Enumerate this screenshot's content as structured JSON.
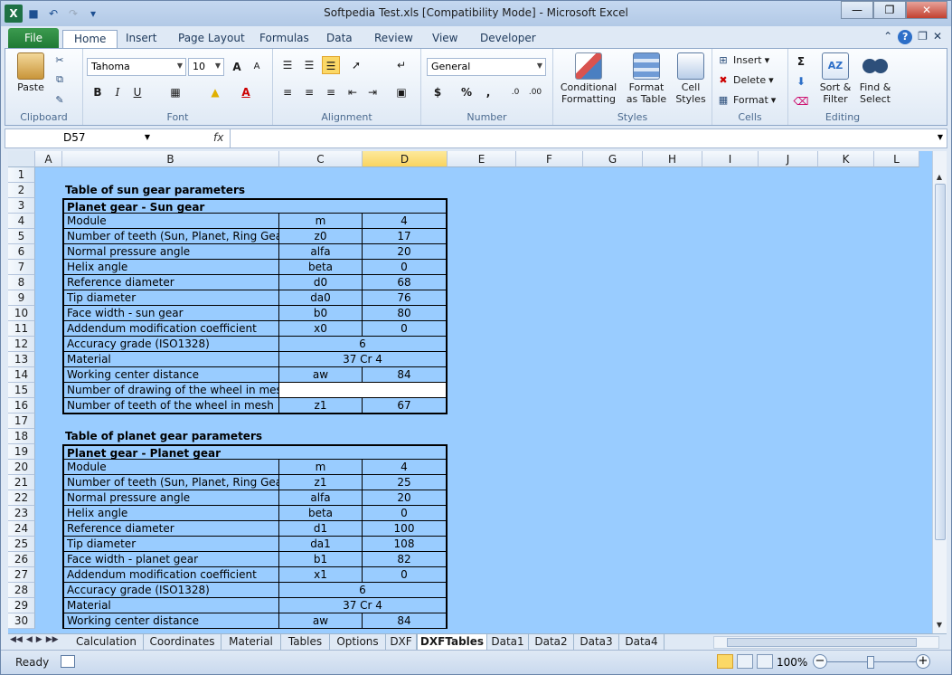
{
  "window": {
    "title": "Softpedia Test.xls  [Compatibility Mode]  -  Microsoft Excel"
  },
  "ribbon_tabs": [
    "File",
    "Home",
    "Insert",
    "Page Layout",
    "Formulas",
    "Data",
    "Review",
    "View",
    "Developer"
  ],
  "ribbon": {
    "clipboard": {
      "paste": "Paste",
      "label": "Clipboard"
    },
    "font": {
      "name": "Tahoma",
      "size": "10",
      "label": "Font",
      "bold": "B",
      "italic": "I",
      "underline": "U"
    },
    "alignment": {
      "label": "Alignment"
    },
    "number": {
      "format": "General",
      "currency": "$",
      "percent": "%",
      "comma": ",",
      "label": "Number"
    },
    "styles": {
      "conditional": "Conditional Formatting",
      "format_table": "Format as Table",
      "cell_styles": "Cell Styles",
      "label": "Styles"
    },
    "cells": {
      "insert": "Insert",
      "delete": "Delete",
      "format": "Format",
      "label": "Cells"
    },
    "editing": {
      "sigma": "Σ",
      "sort": "Sort & Filter",
      "find": "Find & Select",
      "label": "Editing"
    }
  },
  "formula_bar": {
    "name_box": "D57",
    "fx": "fx",
    "value": ""
  },
  "columns": [
    {
      "name": "A",
      "selected": false
    },
    {
      "name": "B",
      "selected": false
    },
    {
      "name": "C",
      "selected": false
    },
    {
      "name": "D",
      "selected": true
    },
    {
      "name": "E",
      "selected": false
    },
    {
      "name": "F",
      "selected": false
    },
    {
      "name": "G",
      "selected": false
    },
    {
      "name": "H",
      "selected": false
    },
    {
      "name": "I",
      "selected": false
    },
    {
      "name": "J",
      "selected": false
    },
    {
      "name": "K",
      "selected": false
    },
    {
      "name": "L",
      "selected": false
    }
  ],
  "rows": [
    {
      "n": "1",
      "b": "",
      "c": "",
      "d": "",
      "kind": "blank"
    },
    {
      "n": "2",
      "b": "Table of sun gear parameters",
      "c": "",
      "d": "",
      "kind": "title"
    },
    {
      "n": "3",
      "b": "Planet gear - Sun gear",
      "c": "",
      "d": "",
      "kind": "header"
    },
    {
      "n": "4",
      "b": "Module",
      "c": "m",
      "d": "4",
      "kind": "data"
    },
    {
      "n": "5",
      "b": "Number of teeth (Sun, Planet, Ring Gear)",
      "c": "z0",
      "d": "17",
      "kind": "data"
    },
    {
      "n": "6",
      "b": "Normal pressure angle",
      "c": "alfa",
      "d": "20",
      "kind": "data"
    },
    {
      "n": "7",
      "b": "Helix angle",
      "c": "beta",
      "d": "0",
      "kind": "data"
    },
    {
      "n": "8",
      "b": "Reference diameter",
      "c": "d0",
      "d": "68",
      "kind": "data"
    },
    {
      "n": "9",
      "b": "Tip diameter",
      "c": "da0",
      "d": "76",
      "kind": "data"
    },
    {
      "n": "10",
      "b": "Face width - sun gear",
      "c": "b0",
      "d": "80",
      "kind": "data"
    },
    {
      "n": "11",
      "b": "Addendum modification coefficient",
      "c": "x0",
      "d": "0",
      "kind": "data"
    },
    {
      "n": "12",
      "b": "Accuracy grade (ISO1328)",
      "c": "6",
      "d": "",
      "kind": "merged"
    },
    {
      "n": "13",
      "b": "Material",
      "c": "37 Cr 4",
      "d": "",
      "kind": "merged"
    },
    {
      "n": "14",
      "b": "Working center distance",
      "c": "aw",
      "d": "84",
      "kind": "data"
    },
    {
      "n": "15",
      "b": "Number of drawing of the wheel in mesh",
      "c": "",
      "d": "",
      "kind": "white"
    },
    {
      "n": "16",
      "b": "Number of teeth of the wheel in mesh",
      "c": "z1",
      "d": "67",
      "kind": "data"
    },
    {
      "n": "17",
      "b": "",
      "c": "",
      "d": "",
      "kind": "blank"
    },
    {
      "n": "18",
      "b": "Table of planet gear parameters",
      "c": "",
      "d": "",
      "kind": "title"
    },
    {
      "n": "19",
      "b": "Planet gear - Planet gear",
      "c": "",
      "d": "",
      "kind": "header"
    },
    {
      "n": "20",
      "b": "Module",
      "c": "m",
      "d": "4",
      "kind": "data"
    },
    {
      "n": "21",
      "b": "Number of teeth (Sun, Planet, Ring Gear)",
      "c": "z1",
      "d": "25",
      "kind": "data"
    },
    {
      "n": "22",
      "b": "Normal pressure angle",
      "c": "alfa",
      "d": "20",
      "kind": "data"
    },
    {
      "n": "23",
      "b": "Helix angle",
      "c": "beta",
      "d": "0",
      "kind": "data"
    },
    {
      "n": "24",
      "b": "Reference diameter",
      "c": "d1",
      "d": "100",
      "kind": "data"
    },
    {
      "n": "25",
      "b": "Tip diameter",
      "c": "da1",
      "d": "108",
      "kind": "data"
    },
    {
      "n": "26",
      "b": "Face width - planet gear",
      "c": "b1",
      "d": "82",
      "kind": "data"
    },
    {
      "n": "27",
      "b": "Addendum modification coefficient",
      "c": "x1",
      "d": "0",
      "kind": "data"
    },
    {
      "n": "28",
      "b": "Accuracy grade (ISO1328)",
      "c": "6",
      "d": "",
      "kind": "merged"
    },
    {
      "n": "29",
      "b": "Material",
      "c": "37 Cr 4",
      "d": "",
      "kind": "merged"
    },
    {
      "n": "30",
      "b": "Working center distance",
      "c": "aw",
      "d": "84",
      "kind": "data"
    }
  ],
  "sheet_tabs": [
    {
      "label": "Calculation",
      "active": false
    },
    {
      "label": "Coordinates",
      "active": false
    },
    {
      "label": "Material",
      "active": false
    },
    {
      "label": "Tables",
      "active": false
    },
    {
      "label": "Options",
      "active": false
    },
    {
      "label": "DXF",
      "active": false
    },
    {
      "label": "DXFTables",
      "active": true
    },
    {
      "label": "Data1",
      "active": false
    },
    {
      "label": "Data2",
      "active": false
    },
    {
      "label": "Data3",
      "active": false
    },
    {
      "label": "Data4",
      "active": false
    }
  ],
  "status": {
    "ready": "Ready",
    "zoom": "100%"
  },
  "colors": {
    "sheet_bg": "#99ccff",
    "selected_col": "#f9d460",
    "file_tab": "#1f7a35"
  }
}
